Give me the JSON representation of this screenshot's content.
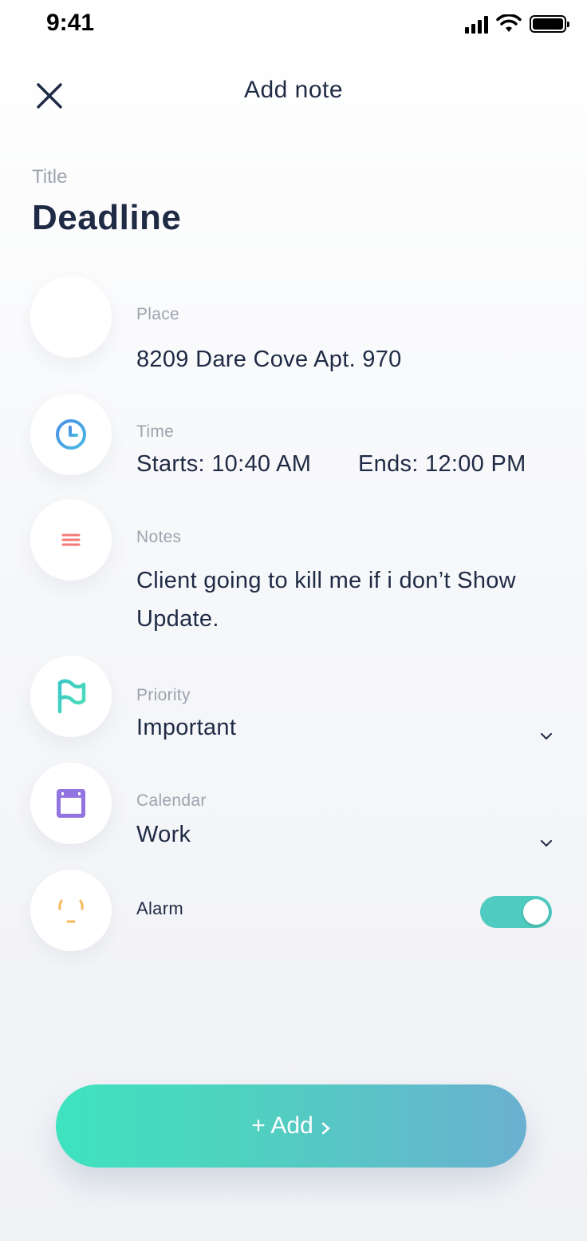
{
  "status_bar": {
    "time": "9:41"
  },
  "header": {
    "title": "Add note",
    "close_icon": "close-icon"
  },
  "title_field": {
    "label": "Title",
    "value": "Deadline"
  },
  "place": {
    "label": "Place",
    "value": "8209 Dare Cove Apt. 970",
    "icon": "place-icon"
  },
  "time": {
    "label": "Time",
    "starts": "Starts: 10:40 AM",
    "ends": "Ends: 12:00 PM",
    "icon": "clock-icon"
  },
  "notes": {
    "label": "Notes",
    "line1": "Client going to kill me if i don’t Show",
    "line2": "Update.",
    "icon": "notes-icon"
  },
  "priority": {
    "label": "Priority",
    "value": "Important",
    "icon": "flag-icon"
  },
  "calendar": {
    "label": "Calendar",
    "value": "Work",
    "icon": "calendar-icon"
  },
  "alarm": {
    "label": "Alarm",
    "enabled": true,
    "icon": "alarm-icon"
  },
  "add_button": {
    "label": "+ Add"
  },
  "colors": {
    "accent_teal": "#4fcbbf",
    "clock_blue": "#4a90e2",
    "notes_red": "#f47a7a",
    "flag_teal": "#45d4c0",
    "calendar_purple": "#9174e0",
    "alarm_orange": "#f6b85a",
    "text_dark": "#1f2a44",
    "label_gray": "#9ea3ae"
  }
}
